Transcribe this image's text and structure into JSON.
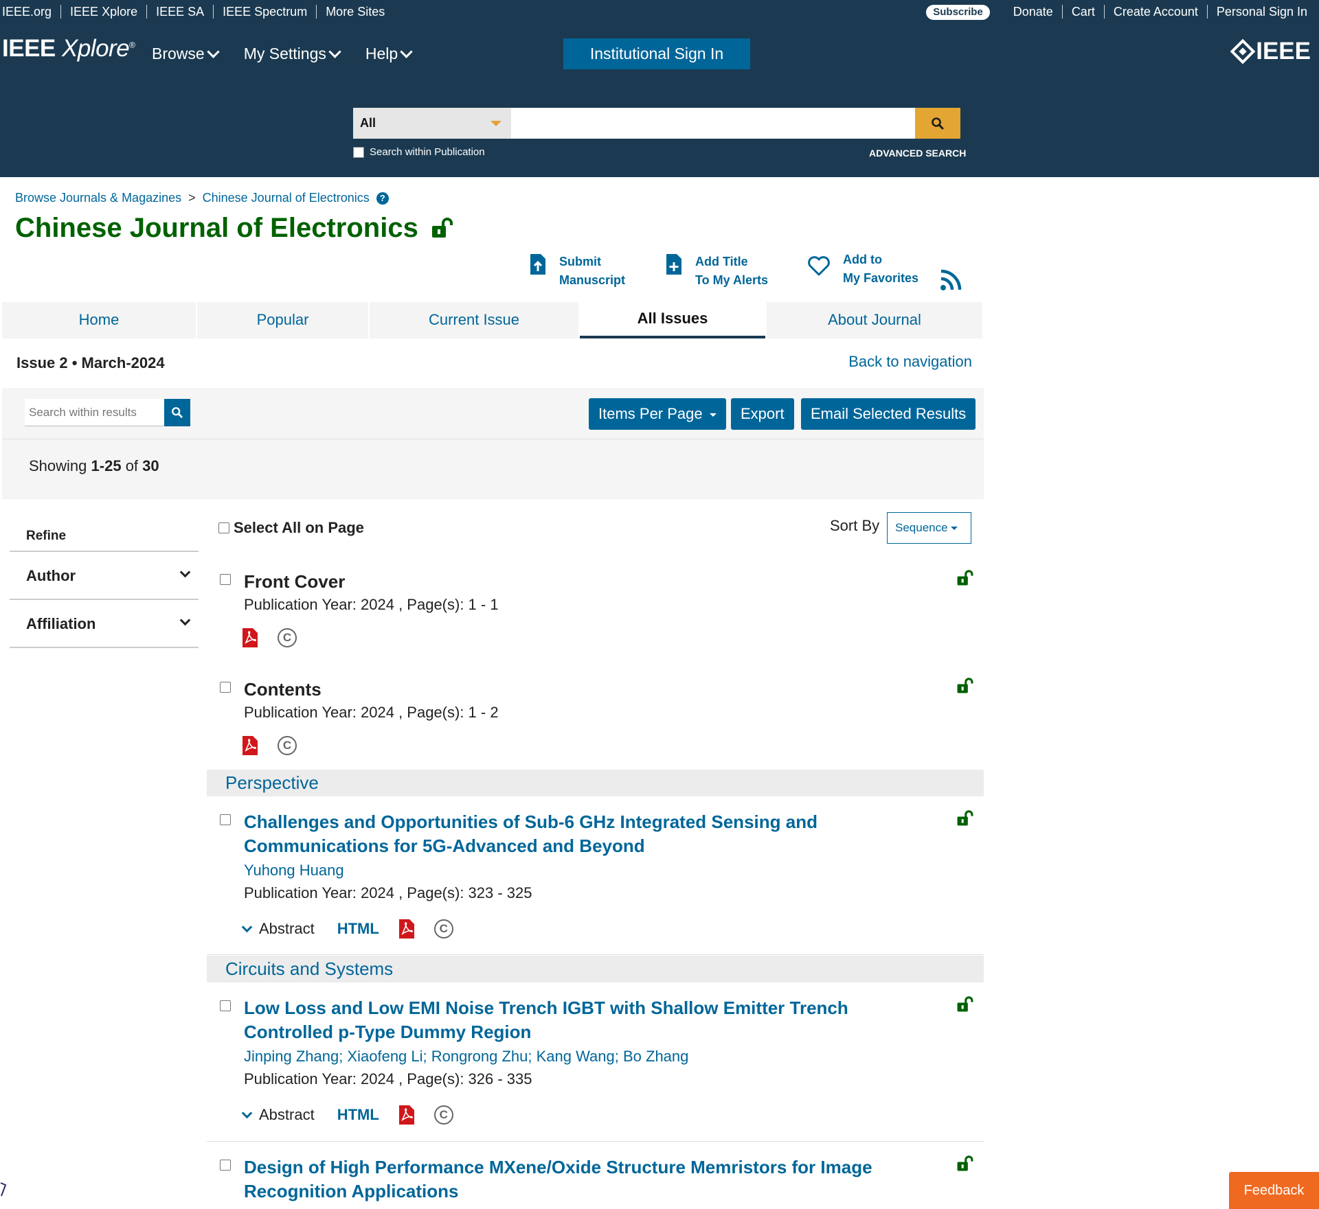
{
  "util_bar": {
    "left_links": [
      "IEEE.org",
      "IEEE Xplore",
      "IEEE SA",
      "IEEE Spectrum",
      "More Sites"
    ],
    "subscribe": "Subscribe",
    "right_links": [
      "Donate",
      "Cart",
      "Create Account",
      "Personal Sign In"
    ]
  },
  "header": {
    "logo_main": "IEEE",
    "logo_x": "Xplore",
    "logo_reg": "®",
    "nav": [
      "Browse",
      "My Settings",
      "Help"
    ],
    "institutional_sign_in": "Institutional Sign In",
    "brand": "IEEE"
  },
  "search": {
    "scope": "All",
    "query": "",
    "within_publication": "Search within Publication",
    "advanced": "ADVANCED SEARCH"
  },
  "breadcrumb": {
    "items": [
      "Browse Journals & Magazines",
      "Chinese Journal of Electronics"
    ],
    "separator": ">",
    "help": "?"
  },
  "journal": {
    "title": "Chinese Journal of Electronics"
  },
  "actions": {
    "submit_line1": "Submit",
    "submit_line2": "Manuscript",
    "alerts_line1": "Add Title",
    "alerts_line2": "To My Alerts",
    "favorites_line1": "Add to",
    "favorites_line2": "My Favorites"
  },
  "tabs": [
    "Home",
    "Popular",
    "Current Issue",
    "All Issues",
    "About Journal"
  ],
  "active_tab": "All Issues",
  "issue": {
    "heading": "Issue 2 • March-2024",
    "back": "Back to navigation"
  },
  "results": {
    "search_placeholder": "Search within results",
    "items_per_page": "Items Per Page",
    "export": "Export",
    "email": "Email Selected Results",
    "showing_prefix": "Showing",
    "showing_range": "1-25",
    "showing_of": "of",
    "showing_total": "30"
  },
  "refine": {
    "title": "Refine",
    "filters": [
      "Author",
      "Affiliation"
    ]
  },
  "list": {
    "select_all": "Select All on Page",
    "sort_by": "Sort By",
    "sort_value": "Sequence",
    "abstract_label": "Abstract",
    "html_label": "HTML",
    "items": [
      {
        "title": "Front Cover",
        "pub": "Publication Year: 2024 , Page(s): 1  -  1"
      },
      {
        "title": "Contents",
        "pub": "Publication Year: 2024 , Page(s): 1  -  2"
      },
      {
        "title": "Challenges and Opportunities of Sub-6 GHz Integrated Sensing and Communications for 5G-Advanced and Beyond",
        "authors": "Yuhong Huang",
        "pub": "Publication Year: 2024 , Page(s): 323  -  325"
      },
      {
        "title": "Low Loss and Low EMI Noise Trench IGBT with Shallow Emitter Trench Controlled p-Type Dummy Region",
        "authors": "Jinping Zhang; Xiaofeng Li; Rongrong Zhu; Kang Wang; Bo Zhang",
        "pub": "Publication Year: 2024 , Page(s): 326  -  335"
      },
      {
        "title": "Design of High Performance MXene/Oxide Structure Memristors for Image Recognition Applications"
      }
    ],
    "sections": [
      "Perspective",
      "Circuits and Systems"
    ]
  },
  "feedback": "Feedback",
  "colors": {
    "navy": "#1b3a51",
    "link_blue": "#006699",
    "title_green": "#006100",
    "search_gold": "#e4a633",
    "feedback_orange": "#ef6921"
  }
}
